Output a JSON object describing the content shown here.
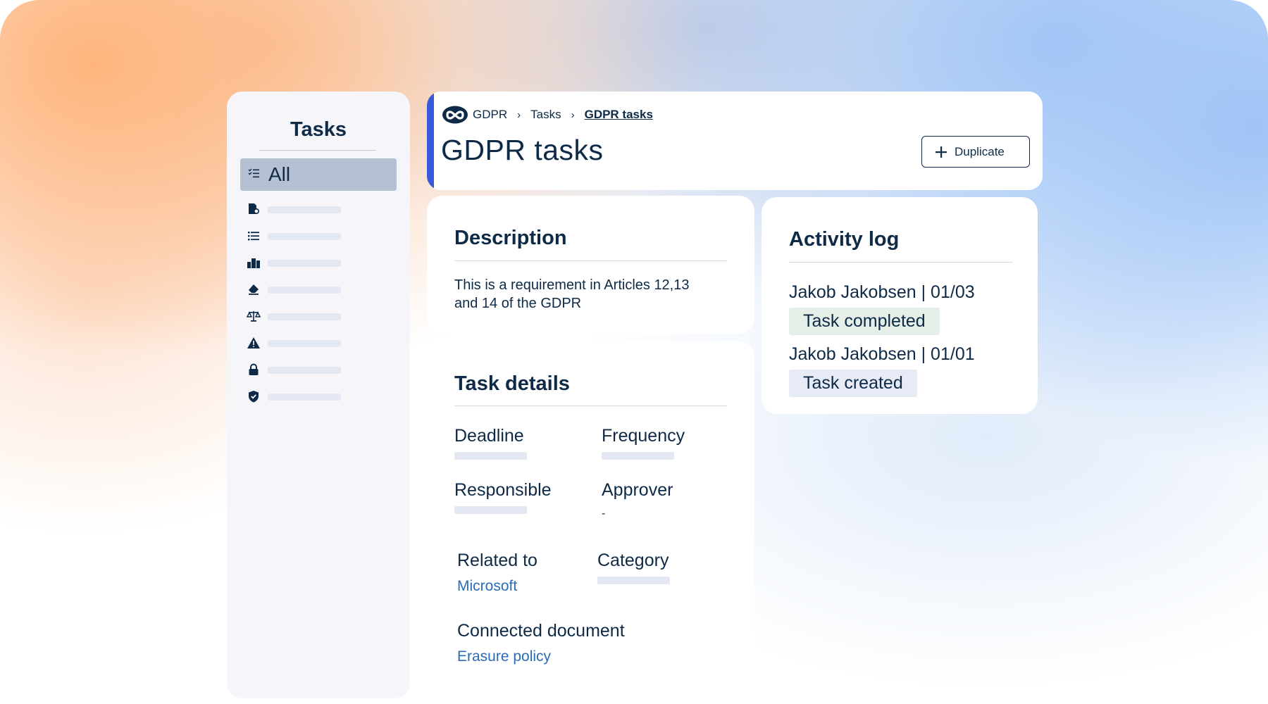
{
  "sidebar": {
    "title": "Tasks",
    "active_item": "All",
    "items": [
      {
        "icon": "document-settings-icon"
      },
      {
        "icon": "list-icon"
      },
      {
        "icon": "building-icon"
      },
      {
        "icon": "eraser-icon"
      },
      {
        "icon": "scales-icon"
      },
      {
        "icon": "warning-icon"
      },
      {
        "icon": "lock-icon"
      },
      {
        "icon": "shield-icon"
      }
    ]
  },
  "header": {
    "breadcrumb": {
      "root": "GDPR",
      "middle": "Tasks",
      "current": "GDPR tasks"
    },
    "title": "GDPR tasks",
    "duplicate_label": "Duplicate",
    "accent_color": "#3a5bd9"
  },
  "description": {
    "title": "Description",
    "text": "This is a requirement in Articles 12,13 and 14 of the GDPR"
  },
  "task_details": {
    "title": "Task details",
    "deadline_label": "Deadline",
    "frequency_label": "Frequency",
    "responsible_label": "Responsible",
    "approver_label": "Approver",
    "approver_value": "-",
    "related_label": "Related to",
    "related_value": "Microsoft",
    "category_label": "Category",
    "document_label": "Connected document",
    "document_value": "Erasure policy"
  },
  "activity_log": {
    "title": "Activity log",
    "entries": [
      {
        "who": "Jakob Jakobsen | 01/03",
        "status": "Task completed"
      },
      {
        "who": "Jakob Jakobsen | 01/01",
        "status": "Task created"
      }
    ]
  },
  "colors": {
    "text": "#0e2a47",
    "link": "#2a6cb8",
    "active_nav": "#b5c0d2",
    "badge_done": "#e5efe8",
    "badge_created": "#e6ebf5"
  }
}
